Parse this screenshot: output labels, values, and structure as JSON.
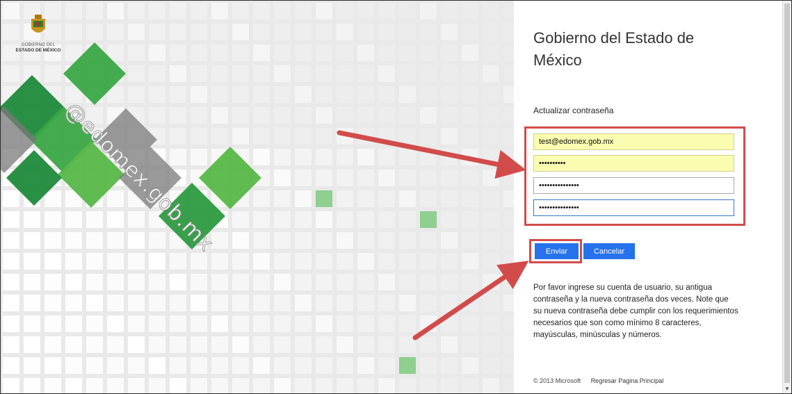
{
  "logo": {
    "line1": "GOBIERNO DEL",
    "line2": "ESTADO DE MÉXICO"
  },
  "watermark": "@edomex.gob.mx",
  "title": "Gobierno del Estado de México",
  "subtitle": "Actualizar contraseña",
  "fields": {
    "username": "test@edomex.gob.mx",
    "old_password": "••••••••••",
    "new_password": "•••••••••••••••",
    "confirm_password": "•••••••••••••••"
  },
  "buttons": {
    "submit": "Enviar",
    "cancel": "Cancelar"
  },
  "info_text": "Por favor ingrese su cuenta de usuario, su antigua contraseña y la nueva contraseña dos veces. Note que su nueva contraseña debe cumplir con los requerimientos necesarios que son como mínimo 8 caracteres, mayúsculas, minúsculas y números.",
  "footer": {
    "copyright": "© 2013 Microsoft",
    "home_link": "Regresar Pagina Principal"
  },
  "colors": {
    "accent": "#2672ec",
    "highlight": "#d24b4b",
    "green": "#2f9e44",
    "autofill": "#fafcb0"
  }
}
